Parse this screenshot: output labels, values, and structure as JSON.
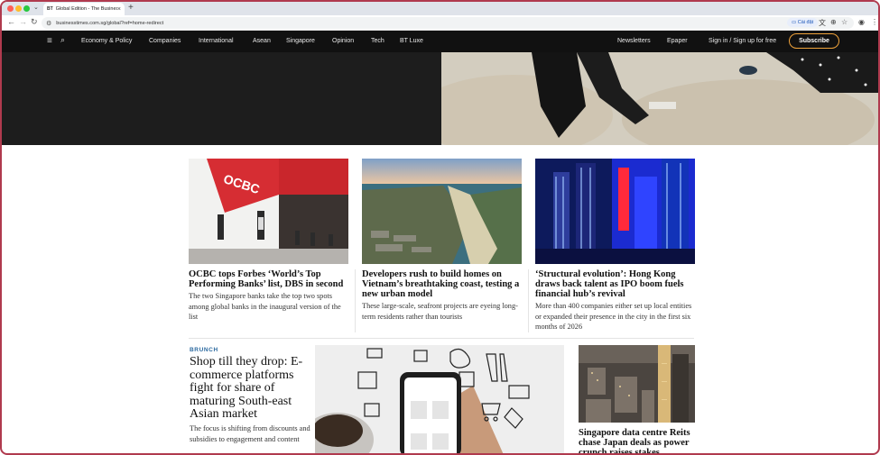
{
  "browser": {
    "tab_favicon": "BT",
    "tab_title": "Global Edition - The Business",
    "url": "businesstimes.com.sg/global?ref=home-redirect",
    "install_label": "Cài đặt"
  },
  "site_nav": {
    "items": [
      "Economy & Policy",
      "Companies",
      "International",
      "Asean",
      "Singapore",
      "Opinion",
      "Tech",
      "BT Luxe"
    ],
    "right": [
      "Newsletters",
      "Epaper",
      "Sign in / Sign up for free"
    ],
    "subscribe": "Subscribe"
  },
  "colors": {
    "accent": "#f0a33b",
    "kicker": "#2c6aa0",
    "nav_bg": "#111111"
  },
  "articles": [
    {
      "headline": "OCBC tops Forbes ‘World’s Top Performing Banks’ list, DBS in second",
      "summary": "The two Singapore banks take the top two spots among global banks in the inaugural version of the list"
    },
    {
      "headline": "Developers rush to build homes on Vietnam’s breathtaking coast, testing a new urban model",
      "summary": "These large-scale, seafront projects are eyeing long-term residents rather than tourists"
    },
    {
      "headline": "‘Structural evolution’: Hong Kong draws back talent as IPO boom fuels financial hub’s revival",
      "summary": "More than 400 companies either set up local entities or expanded their presence in the city in the first six months of 2026"
    }
  ],
  "feature": {
    "kicker": "BRUNCH",
    "headline": "Shop till they drop: E-commerce platforms fight for share of maturing South-east Asian market",
    "summary": "The focus is shifting from discounts and subsidies to engagement and content"
  },
  "side_story": {
    "headline": "Singapore data centre Reits chase Japan deals as power crunch raises stakes"
  },
  "image_text": {
    "ocbc_sign": "OCBC"
  }
}
